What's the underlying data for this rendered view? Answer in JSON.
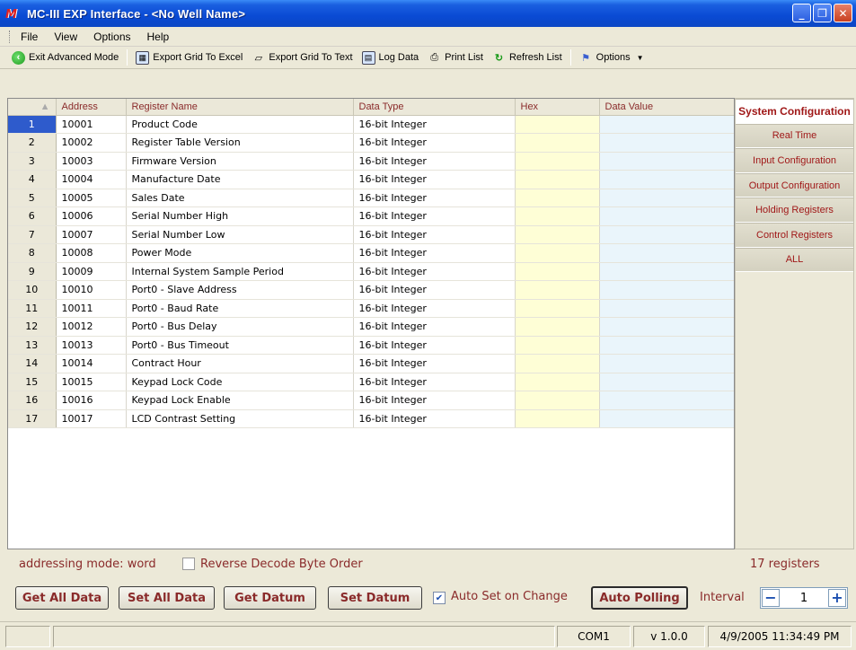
{
  "window": {
    "title": "MC-III EXP Interface - <No Well Name>"
  },
  "menu": [
    "File",
    "View",
    "Options",
    "Help"
  ],
  "toolbar": {
    "exit_advanced": "Exit Advanced Mode",
    "export_excel": "Export Grid To Excel",
    "export_text": "Export Grid To Text",
    "log_data": "Log Data",
    "print_list": "Print List",
    "refresh_list": "Refresh List",
    "options": "Options"
  },
  "grid": {
    "columns": [
      "",
      "Address",
      "Register Name",
      "Data Type",
      "Hex",
      "Data Value"
    ],
    "rows": [
      {
        "num": "1",
        "address": "10001",
        "name": "Product Code",
        "type": "16-bit Integer",
        "hex": "",
        "value": ""
      },
      {
        "num": "2",
        "address": "10002",
        "name": "Register Table Version",
        "type": "16-bit Integer",
        "hex": "",
        "value": ""
      },
      {
        "num": "3",
        "address": "10003",
        "name": "Firmware Version",
        "type": "16-bit Integer",
        "hex": "",
        "value": ""
      },
      {
        "num": "4",
        "address": "10004",
        "name": "Manufacture Date",
        "type": "16-bit Integer",
        "hex": "",
        "value": ""
      },
      {
        "num": "5",
        "address": "10005",
        "name": "Sales Date",
        "type": "16-bit Integer",
        "hex": "",
        "value": ""
      },
      {
        "num": "6",
        "address": "10006",
        "name": "Serial Number High",
        "type": "16-bit Integer",
        "hex": "",
        "value": ""
      },
      {
        "num": "7",
        "address": "10007",
        "name": "Serial Number Low",
        "type": "16-bit Integer",
        "hex": "",
        "value": ""
      },
      {
        "num": "8",
        "address": "10008",
        "name": "Power Mode",
        "type": "16-bit Integer",
        "hex": "",
        "value": ""
      },
      {
        "num": "9",
        "address": "10009",
        "name": "Internal System Sample Period",
        "type": "16-bit Integer",
        "hex": "",
        "value": ""
      },
      {
        "num": "10",
        "address": "10010",
        "name": "Port0 - Slave Address",
        "type": "16-bit Integer",
        "hex": "",
        "value": ""
      },
      {
        "num": "11",
        "address": "10011",
        "name": "Port0 - Baud Rate",
        "type": "16-bit Integer",
        "hex": "",
        "value": ""
      },
      {
        "num": "12",
        "address": "10012",
        "name": "Port0 - Bus Delay",
        "type": "16-bit Integer",
        "hex": "",
        "value": ""
      },
      {
        "num": "13",
        "address": "10013",
        "name": "Port0 - Bus Timeout",
        "type": "16-bit Integer",
        "hex": "",
        "value": ""
      },
      {
        "num": "14",
        "address": "10014",
        "name": "Contract Hour",
        "type": "16-bit Integer",
        "hex": "",
        "value": ""
      },
      {
        "num": "15",
        "address": "10015",
        "name": "Keypad Lock Code",
        "type": "16-bit Integer",
        "hex": "",
        "value": ""
      },
      {
        "num": "16",
        "address": "10016",
        "name": "Keypad Lock Enable",
        "type": "16-bit Integer",
        "hex": "",
        "value": ""
      },
      {
        "num": "17",
        "address": "10017",
        "name": "LCD Contrast Setting",
        "type": "16-bit Integer",
        "hex": "",
        "value": ""
      }
    ]
  },
  "side_tabs": [
    "System Configuration",
    "Real Time",
    "Input Configuration",
    "Output Configuration",
    "Holding Registers",
    "Control Registers",
    "ALL"
  ],
  "info": {
    "addressing_mode": "addressing mode: word",
    "reverse_label": "Reverse Decode Byte Order",
    "reverse_checked": false,
    "register_count": "17 registers"
  },
  "buttons": {
    "get_all": "Get All Data",
    "set_all": "Set All Data",
    "get_datum": "Get Datum",
    "set_datum": "Set Datum",
    "auto_set_label": "Auto Set on Change",
    "auto_set_checked": true,
    "auto_polling": "Auto Polling",
    "interval_label": "Interval",
    "interval_value": "1"
  },
  "status": {
    "port": "COM1",
    "version": "v 1.0.0",
    "datetime": "4/9/2005 11:34:49 PM"
  }
}
